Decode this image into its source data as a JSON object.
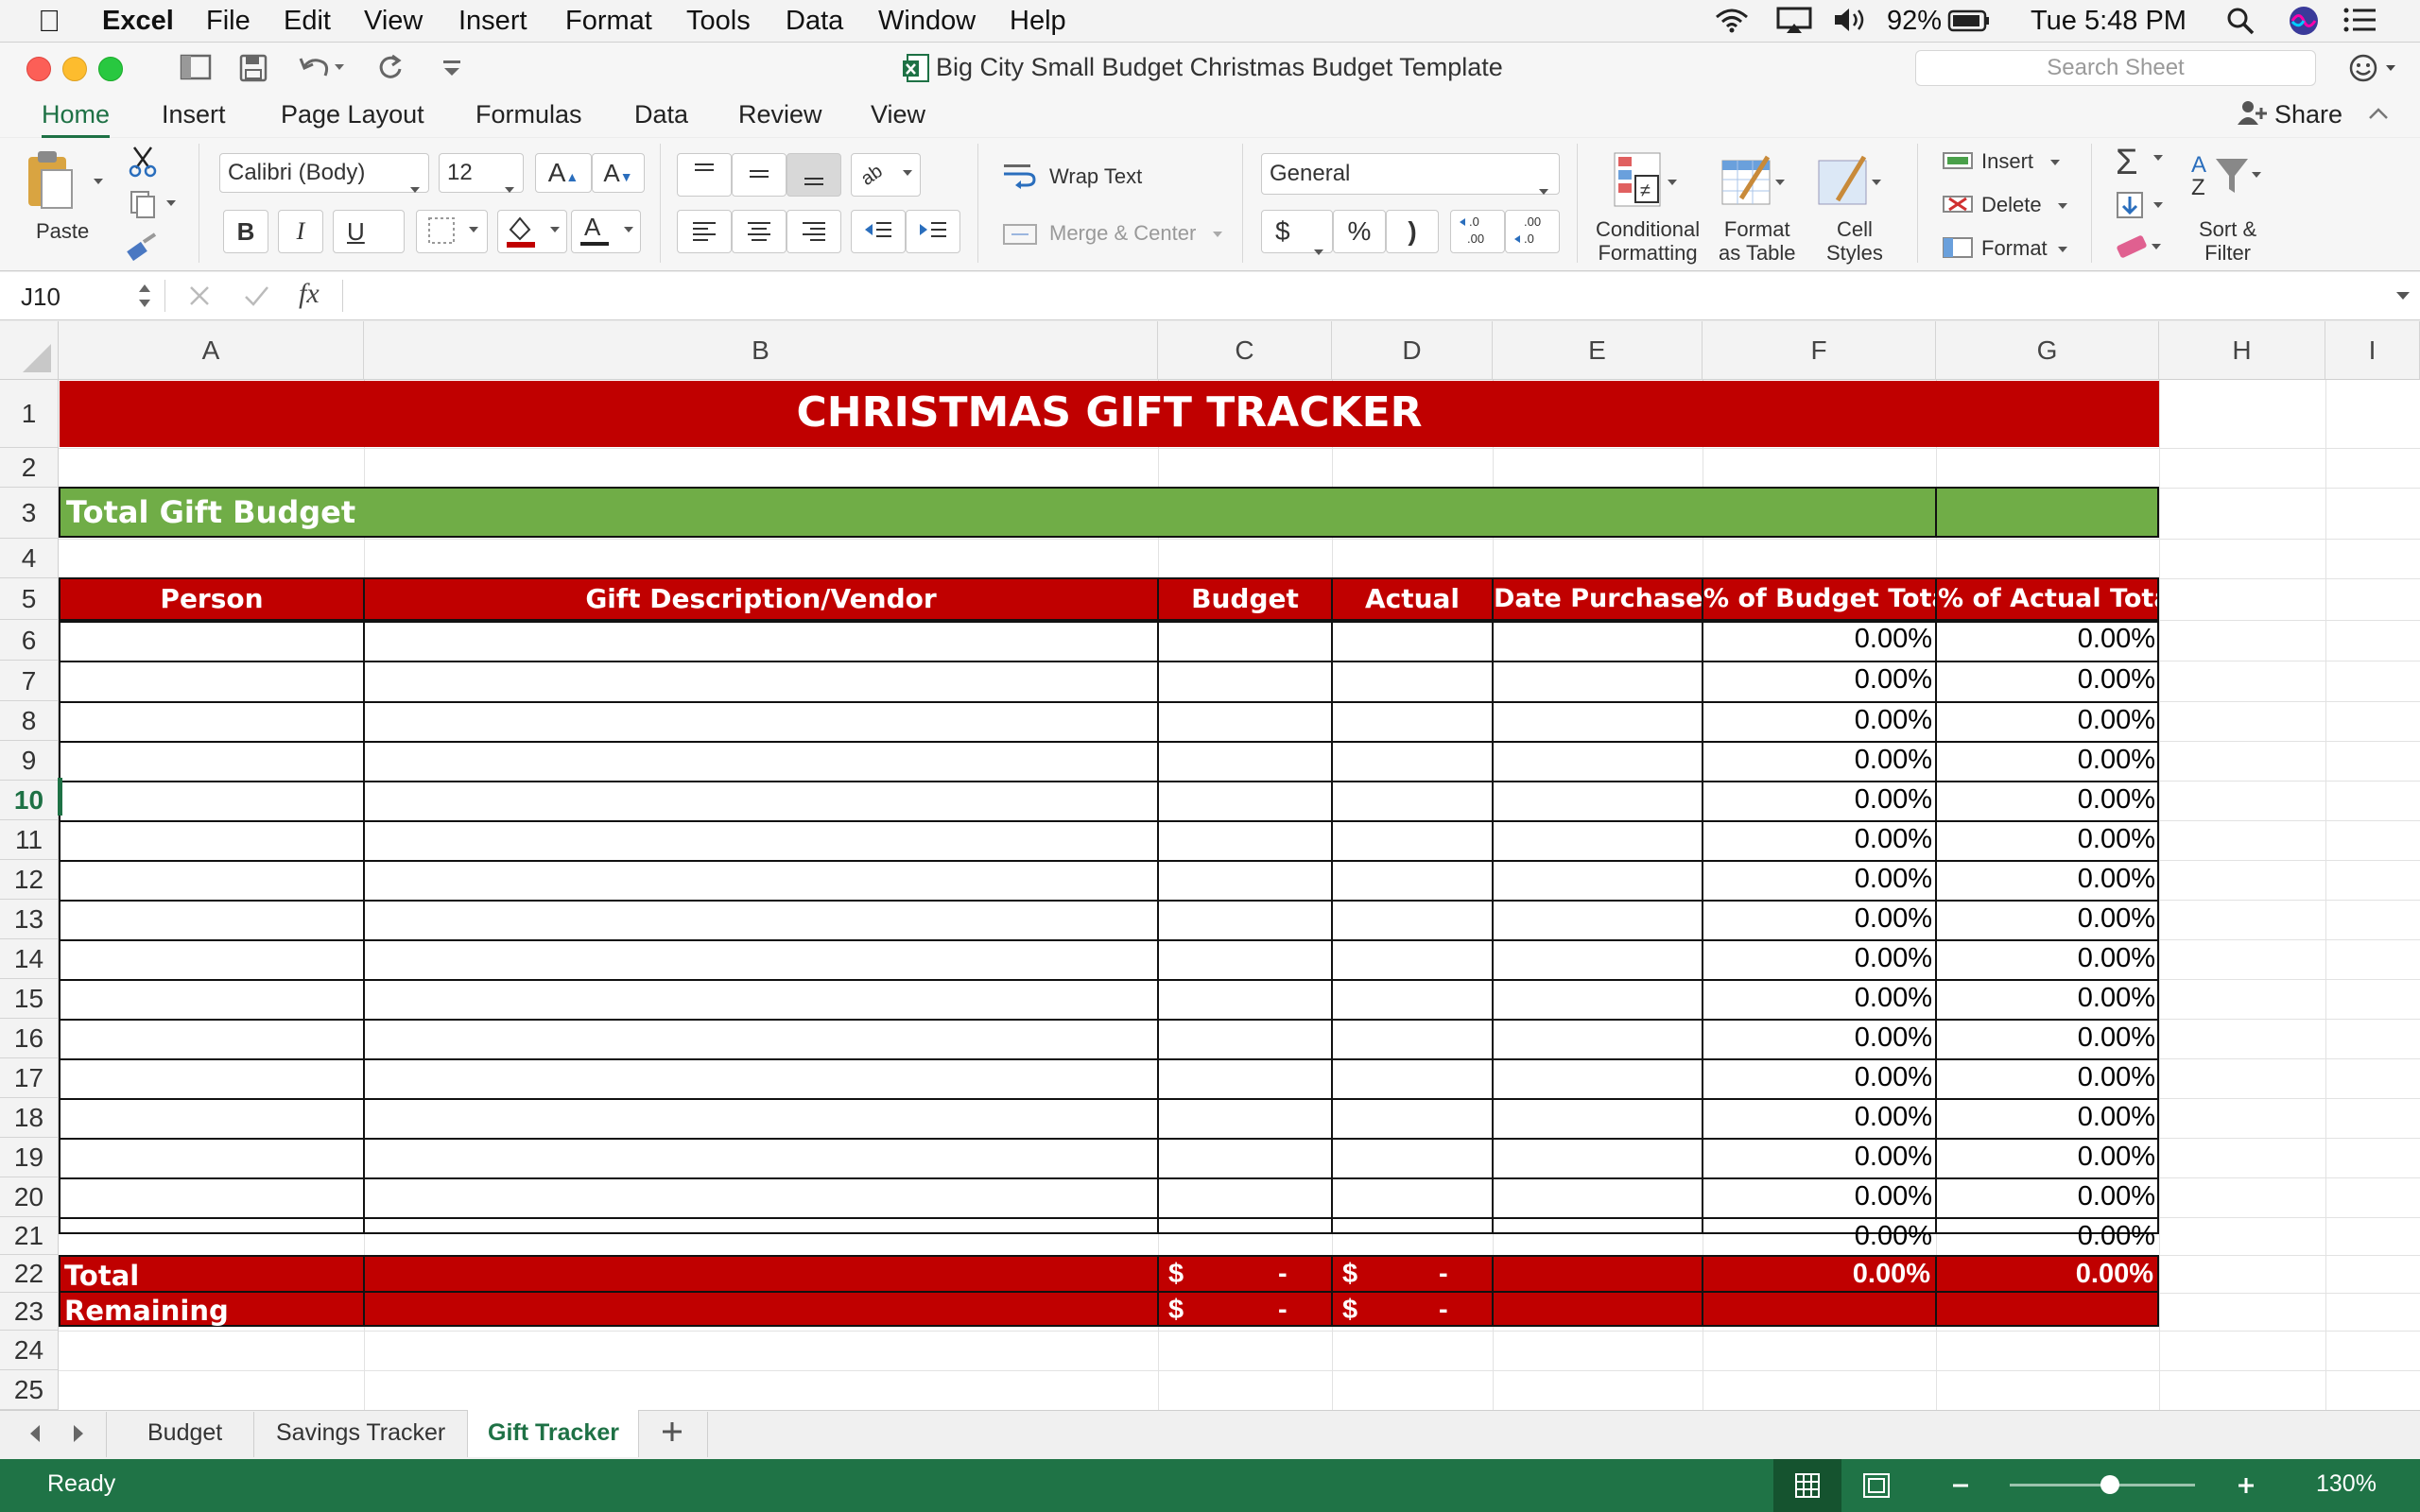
{
  "menubar": {
    "app": "Excel",
    "items": [
      "File",
      "Edit",
      "View",
      "Insert",
      "Format",
      "Tools",
      "Data",
      "Window",
      "Help"
    ],
    "battery": "92%",
    "clock": "Tue 5:48 PM"
  },
  "window": {
    "title": "Big City Small Budget Christmas Budget Template",
    "search_placeholder": "Search Sheet"
  },
  "tabs": [
    "Home",
    "Insert",
    "Page Layout",
    "Formulas",
    "Data",
    "Review",
    "View"
  ],
  "share_label": "Share",
  "ribbon": {
    "paste": "Paste",
    "font_name": "Calibri (Body)",
    "font_size": "12",
    "bold": "B",
    "italic": "I",
    "underline": "U",
    "wrap_text": "Wrap Text",
    "merge_center": "Merge & Center",
    "number_format": "General",
    "currency": "$",
    "percent": "%",
    "comma": ")",
    "conditional_formatting": [
      "Conditional",
      "Formatting"
    ],
    "format_as_table": [
      "Format",
      "as Table"
    ],
    "cell_styles": [
      "Cell",
      "Styles"
    ],
    "insert": "Insert",
    "delete": "Delete",
    "format": "Format",
    "sort_filter": [
      "Sort &",
      "Filter"
    ]
  },
  "formula_bar": {
    "name_box": "J10",
    "fx": "fx",
    "value": ""
  },
  "columns": [
    "A",
    "B",
    "C",
    "D",
    "E",
    "F",
    "G",
    "H",
    "I"
  ],
  "rows": [
    "1",
    "2",
    "3",
    "4",
    "5",
    "6",
    "7",
    "8",
    "9",
    "10",
    "11",
    "12",
    "13",
    "14",
    "15",
    "16",
    "17",
    "18",
    "19",
    "20",
    "21",
    "22",
    "23",
    "24",
    "25"
  ],
  "sheet": {
    "title": "CHRISTMAS GIFT TRACKER",
    "total_budget_label": "Total Gift Budget",
    "headers": [
      "Person",
      "Gift Description/Vendor",
      "Budget",
      "Actual",
      "Date Purchased",
      "% of Budget Total",
      "% of Actual Total"
    ],
    "pct_budget": [
      "0.00%",
      "0.00%",
      "0.00%",
      "0.00%",
      "0.00%",
      "0.00%",
      "0.00%",
      "0.00%",
      "0.00%",
      "0.00%",
      "0.00%",
      "0.00%",
      "0.00%",
      "0.00%",
      "0.00%",
      "0.00%"
    ],
    "pct_actual": [
      "0.00%",
      "0.00%",
      "0.00%",
      "0.00%",
      "0.00%",
      "0.00%",
      "0.00%",
      "0.00%",
      "0.00%",
      "0.00%",
      "0.00%",
      "0.00%",
      "0.00%",
      "0.00%",
      "0.00%",
      "0.00%"
    ],
    "total_label": "Total",
    "remaining_label": "Remaining",
    "currency_symbol": "$",
    "dash": "-",
    "total_pct_budget": "0.00%",
    "total_pct_actual": "0.00%"
  },
  "sheet_tabs": [
    "Budget",
    "Savings Tracker",
    "Gift Tracker"
  ],
  "active_sheet": "Gift Tracker",
  "status": {
    "text": "Ready",
    "zoom": "130%"
  },
  "colors": {
    "accent_green": "#1e7145",
    "title_red": "#c00000",
    "budget_green": "#70ad47"
  }
}
